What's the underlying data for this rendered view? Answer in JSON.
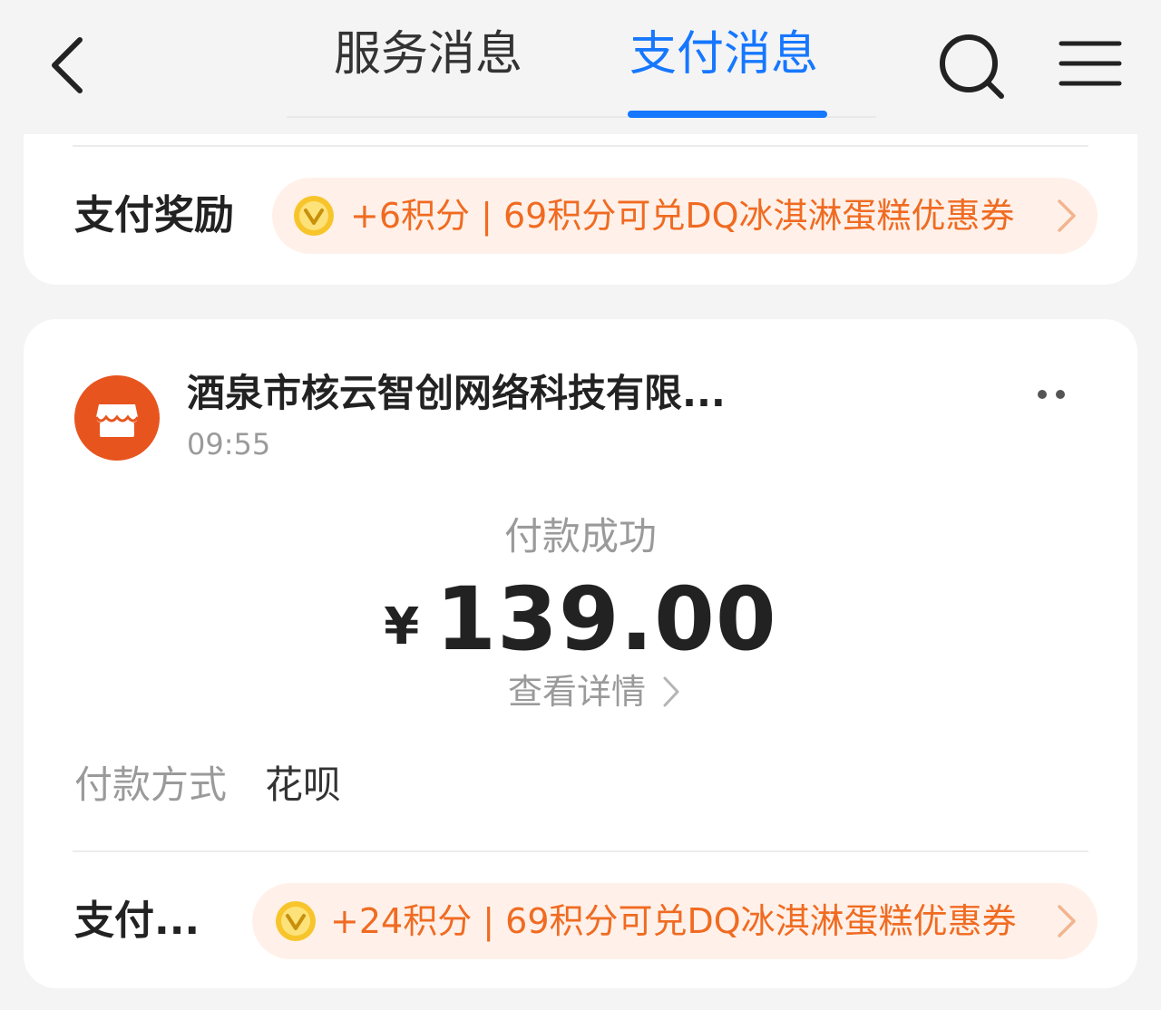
{
  "header": {
    "tabs": [
      {
        "label": "服务消息",
        "active": false
      },
      {
        "label": "支付消息",
        "active": true
      }
    ],
    "accent_color": "#1677ff"
  },
  "card_top": {
    "reward_label": "支付奖励",
    "reward_text": "+6积分 | 69积分可兑DQ冰淇淋蛋糕优惠券"
  },
  "card_payment": {
    "merchant_name": "酒泉市核云智创网络科技有限...",
    "time": "09:55",
    "status": "付款成功",
    "currency": "¥",
    "amount": "139.00",
    "detail_link": "查看详情",
    "payment_method_label": "付款方式",
    "payment_method_value": "花呗",
    "reward_label": "支付...",
    "reward_text": "+24积分 | 69积分可兑DQ冰淇淋蛋糕优惠券"
  },
  "colors": {
    "reward_orange": "#f06b22",
    "reward_bg": "#fff1e9",
    "merchant_avatar": "#e8541e"
  },
  "icons": {
    "back": "chevron-left-icon",
    "search": "search-icon",
    "menu": "menu-icon",
    "coin": "coin-icon",
    "store": "store-icon",
    "more": "more-dots-icon"
  }
}
